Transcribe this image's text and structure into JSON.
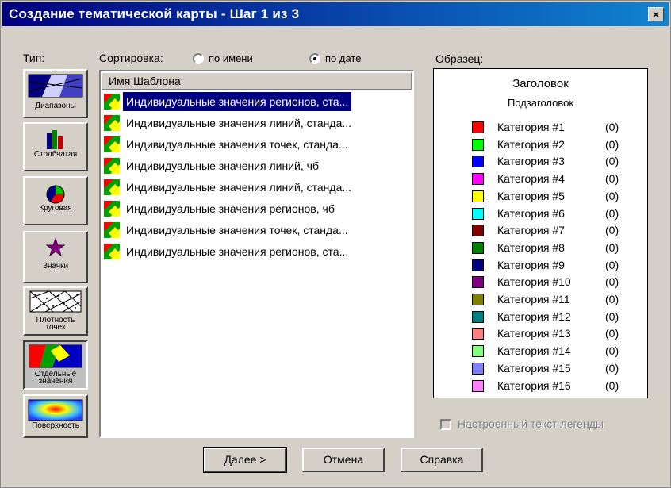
{
  "window": {
    "title": "Создание тематической карты - Шаг 1 из 3",
    "close_glyph": "×"
  },
  "type_label": "Тип:",
  "types": [
    {
      "id": "ranges",
      "label": "Диапазоны",
      "icon": "ranges-icon"
    },
    {
      "id": "bar",
      "label": "Столбчатая",
      "icon": "bar-chart-icon"
    },
    {
      "id": "pie",
      "label": "Круговая",
      "icon": "pie-chart-icon"
    },
    {
      "id": "symbols",
      "label": "Значки",
      "icon": "star-icon"
    },
    {
      "id": "density",
      "label": "Плотность точек",
      "label_line1": "Плотность",
      "label_line2": "точек",
      "icon": "dot-density-icon"
    },
    {
      "id": "individual",
      "label": "Отдельные значения",
      "label_line1": "Отдельные",
      "label_line2": "значения",
      "icon": "individual-values-icon",
      "selected": true
    },
    {
      "id": "surface",
      "label": "Поверхность",
      "icon": "surface-icon"
    }
  ],
  "sort": {
    "label": "Сортировка:",
    "by_name": "по имени",
    "by_date": "по дате",
    "selected": "by_date"
  },
  "list": {
    "header": "Имя Шаблона",
    "items": [
      {
        "text": "Индивидуальные значения регионов, ста...",
        "selected": true
      },
      {
        "text": "Индивидуальные значения линий, станда..."
      },
      {
        "text": "Индивидуальные значения точек, станда..."
      },
      {
        "text": "Индивидуальные значения линий, чб"
      },
      {
        "text": "Индивидуальные значения линий, станда..."
      },
      {
        "text": "Индивидуальные значения регионов, чб"
      },
      {
        "text": "Индивидуальные значения точек, станда..."
      },
      {
        "text": "Индивидуальные значения регионов, ста..."
      }
    ]
  },
  "sample": {
    "label": "Образец:",
    "title": "Заголовок",
    "subtitle": "Подзаголовок",
    "legend": [
      {
        "name": "Категория #1",
        "count": "(0)",
        "color": "#ff0000"
      },
      {
        "name": "Категория #2",
        "count": "(0)",
        "color": "#00ff00"
      },
      {
        "name": "Категория #3",
        "count": "(0)",
        "color": "#0000ff"
      },
      {
        "name": "Категория #4",
        "count": "(0)",
        "color": "#ff00ff"
      },
      {
        "name": "Категория #5",
        "count": "(0)",
        "color": "#ffff00"
      },
      {
        "name": "Категория #6",
        "count": "(0)",
        "color": "#00ffff"
      },
      {
        "name": "Категория #7",
        "count": "(0)",
        "color": "#800000"
      },
      {
        "name": "Категория #8",
        "count": "(0)",
        "color": "#008000"
      },
      {
        "name": "Категория #9",
        "count": "(0)",
        "color": "#000080"
      },
      {
        "name": "Категория #10",
        "count": "(0)",
        "color": "#800080"
      },
      {
        "name": "Категория #11",
        "count": "(0)",
        "color": "#808000"
      },
      {
        "name": "Категория #12",
        "count": "(0)",
        "color": "#008080"
      },
      {
        "name": "Категория #13",
        "count": "(0)",
        "color": "#ff8080"
      },
      {
        "name": "Категория #14",
        "count": "(0)",
        "color": "#80ff80"
      },
      {
        "name": "Категория #15",
        "count": "(0)",
        "color": "#8080ff"
      },
      {
        "name": "Категория #16",
        "count": "(0)",
        "color": "#ff80ff"
      }
    ]
  },
  "custom_legend_text": {
    "label": "Настроенный текст легенды",
    "checked": false,
    "enabled": false
  },
  "buttons": {
    "next": "Далее >",
    "cancel": "Отмена",
    "help": "Справка"
  }
}
